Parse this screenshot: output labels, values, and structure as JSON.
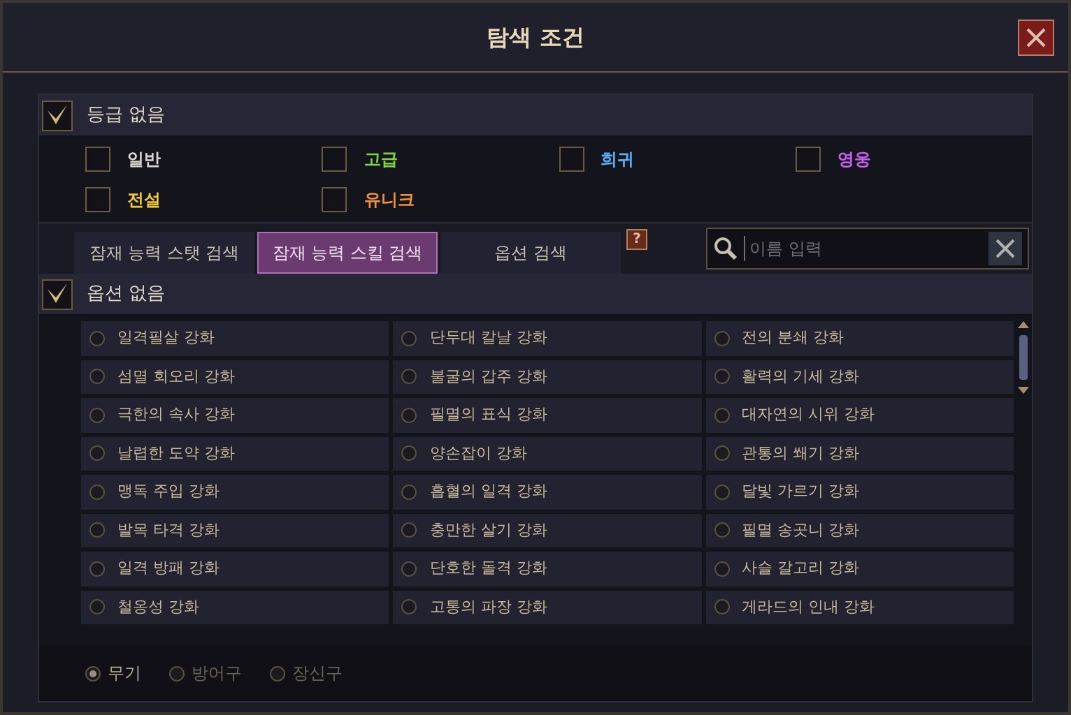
{
  "window": {
    "title": "탐색 조건"
  },
  "grade_filter": {
    "label": "등급 없음",
    "checked": true,
    "grades": [
      {
        "label": "일반",
        "checked": false,
        "color": "#d8d4cc"
      },
      {
        "label": "고급",
        "checked": false,
        "color": "#7fd04a"
      },
      {
        "label": "희귀",
        "checked": false,
        "color": "#5aaef0"
      },
      {
        "label": "영웅",
        "checked": false,
        "color": "#c860f0"
      },
      {
        "label": "전설",
        "checked": false,
        "color": "#f0c838"
      },
      {
        "label": "유니크",
        "checked": false,
        "color": "#ee9040"
      }
    ]
  },
  "tabs": [
    {
      "label": "잠재 능력 스탯 검색",
      "selected": false
    },
    {
      "label": "잠재 능력 스킬 검색",
      "selected": true
    },
    {
      "label": "옵션 검색",
      "selected": false
    }
  ],
  "help": "?",
  "search": {
    "placeholder": "이름 입력"
  },
  "option_filter": {
    "label": "옵션 없음",
    "checked": true
  },
  "skills": [
    {
      "label": "일격필살 강화",
      "selected": false
    },
    {
      "label": "단두대 칼날 강화",
      "selected": false
    },
    {
      "label": "전의 분쇄 강화",
      "selected": false
    },
    {
      "label": "섬멸 회오리 강화",
      "selected": false
    },
    {
      "label": "불굴의 갑주 강화",
      "selected": false
    },
    {
      "label": "활력의 기세 강화",
      "selected": false
    },
    {
      "label": "극한의 속사 강화",
      "selected": false
    },
    {
      "label": "필멸의 표식 강화",
      "selected": false
    },
    {
      "label": "대자연의 시위 강화",
      "selected": false
    },
    {
      "label": "날렵한 도약 강화",
      "selected": false
    },
    {
      "label": "양손잡이 강화",
      "selected": false
    },
    {
      "label": "관통의 쐐기 강화",
      "selected": false
    },
    {
      "label": "맹독 주입 강화",
      "selected": false
    },
    {
      "label": "흡혈의 일격 강화",
      "selected": false
    },
    {
      "label": "달빛 가르기 강화",
      "selected": false
    },
    {
      "label": "발목 타격 강화",
      "selected": false
    },
    {
      "label": "충만한 살기 강화",
      "selected": false
    },
    {
      "label": "필멸 송곳니 강화",
      "selected": false
    },
    {
      "label": "일격 방패 강화",
      "selected": false
    },
    {
      "label": "단호한 돌격 강화",
      "selected": false
    },
    {
      "label": "사슬 갈고리 강화",
      "selected": false
    },
    {
      "label": "철옹성 강화",
      "selected": false
    },
    {
      "label": "고통의 파장 강화",
      "selected": false
    },
    {
      "label": "게라드의 인내 강화",
      "selected": false
    }
  ],
  "equipment_types": [
    {
      "label": "무기",
      "selected": true
    },
    {
      "label": "방어구",
      "selected": false
    },
    {
      "label": "장신구",
      "selected": false
    }
  ]
}
